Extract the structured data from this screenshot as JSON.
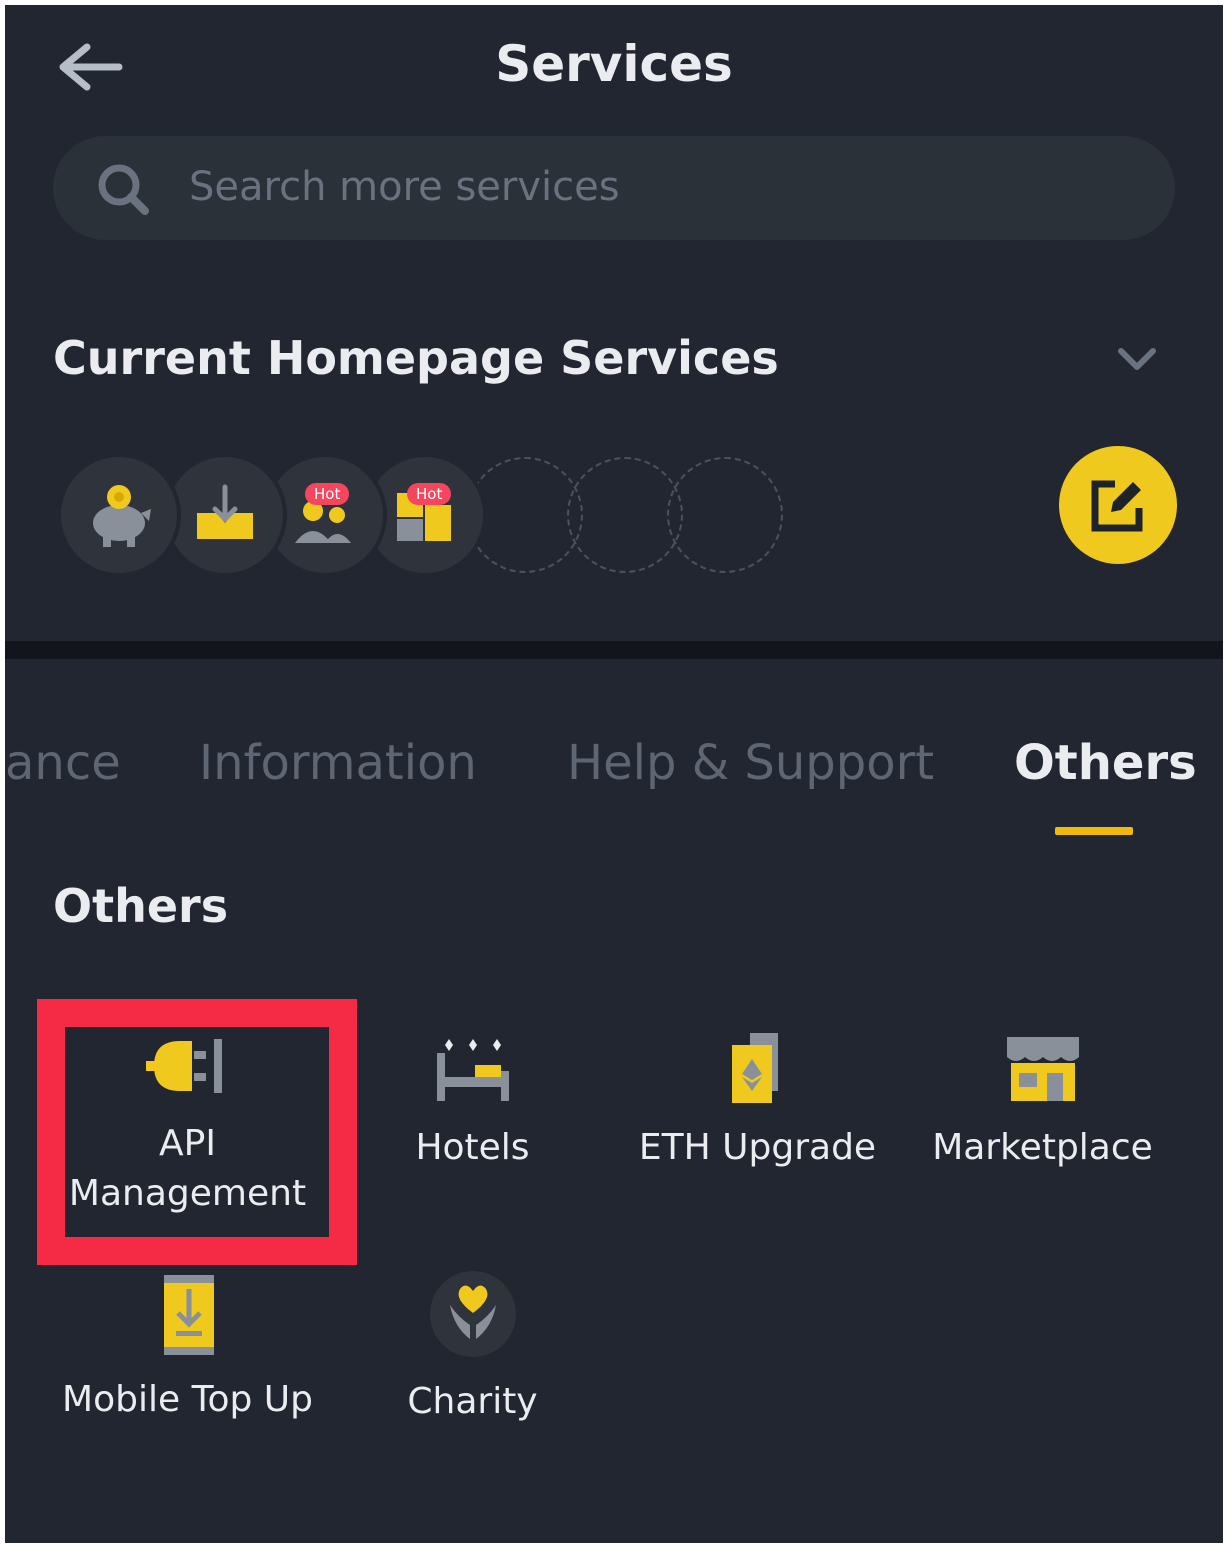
{
  "header": {
    "title": "Services",
    "back_icon": "arrow-left-icon"
  },
  "search": {
    "placeholder": "Search more services",
    "value": ""
  },
  "homepage": {
    "heading": "Current Homepage Services",
    "slots": [
      {
        "icon": "piggy-bank-icon",
        "badge": ""
      },
      {
        "icon": "deposit-icon",
        "badge": ""
      },
      {
        "icon": "users-icon",
        "badge": "Hot"
      },
      {
        "icon": "grid-blocks-icon",
        "badge": "Hot"
      }
    ],
    "empty_slots": 3
  },
  "tabs": [
    {
      "label": "ance",
      "active": false
    },
    {
      "label": "Information",
      "active": false
    },
    {
      "label": "Help & Support",
      "active": false
    },
    {
      "label": "Others",
      "active": true
    }
  ],
  "section": {
    "heading": "Others",
    "items": [
      {
        "label": "API\nManagement",
        "icon": "plug-icon",
        "highlighted": true
      },
      {
        "label": "Hotels",
        "icon": "bed-icon"
      },
      {
        "label": "ETH Upgrade",
        "icon": "ethereum-icon"
      },
      {
        "label": "Marketplace",
        "icon": "storefront-icon"
      },
      {
        "label": "Mobile Top Up",
        "icon": "phone-download-icon"
      },
      {
        "label": "Charity",
        "icon": "heart-hands-icon"
      }
    ]
  },
  "colors": {
    "background": "#222630",
    "accent": "#f0b90b",
    "highlight": "#f52b45",
    "hot": "#f6465d"
  }
}
